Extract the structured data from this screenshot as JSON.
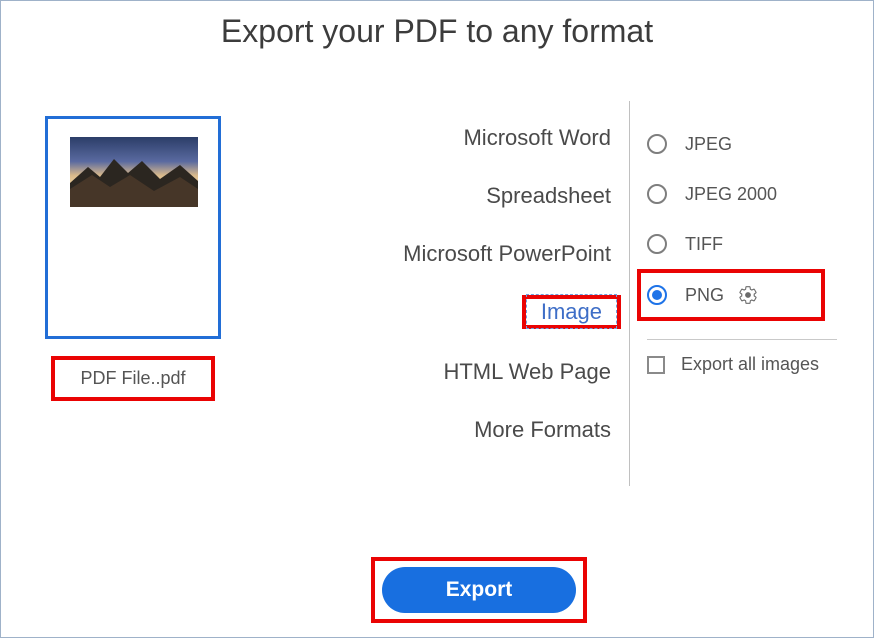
{
  "title": "Export your PDF to any format",
  "preview": {
    "filename": "PDF File..pdf"
  },
  "formats": [
    {
      "id": "word",
      "label": "Microsoft Word"
    },
    {
      "id": "sheet",
      "label": "Spreadsheet"
    },
    {
      "id": "ppt",
      "label": "Microsoft PowerPoint"
    },
    {
      "id": "image",
      "label": "Image",
      "selected": true
    },
    {
      "id": "html",
      "label": "HTML Web Page"
    },
    {
      "id": "more",
      "label": "More Formats"
    }
  ],
  "sub_options": {
    "items": [
      {
        "id": "jpeg",
        "label": "JPEG",
        "selected": false
      },
      {
        "id": "jp2k",
        "label": "JPEG 2000",
        "selected": false
      },
      {
        "id": "tiff",
        "label": "TIFF",
        "selected": false
      },
      {
        "id": "png",
        "label": "PNG",
        "selected": true
      }
    ],
    "export_all_label": "Export all images",
    "export_all_checked": false
  },
  "export_label": "Export"
}
